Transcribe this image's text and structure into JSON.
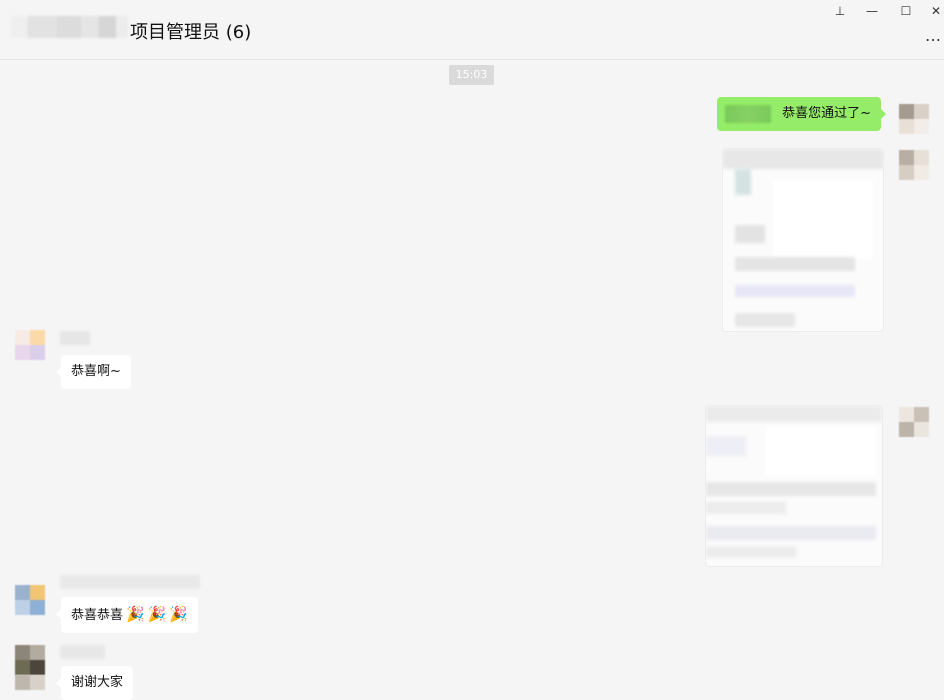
{
  "chat": {
    "title": "项目管理员 (6)",
    "time_divider": "15:03"
  },
  "window_controls": {
    "pin": "⊥",
    "minimize": "—",
    "maximize": "☐",
    "close": "✕",
    "more": "…"
  },
  "messages": {
    "outgoing_text": "恭喜您通过了~",
    "incoming_1": "恭喜啊~",
    "incoming_2_text": "恭喜恭喜",
    "incoming_2_emoji": "🎉",
    "incoming_3": "谢谢大家"
  },
  "colors": {
    "outgoing_bubble": "#95ec69",
    "incoming_bubble": "#ffffff",
    "background": "#f5f5f5"
  }
}
